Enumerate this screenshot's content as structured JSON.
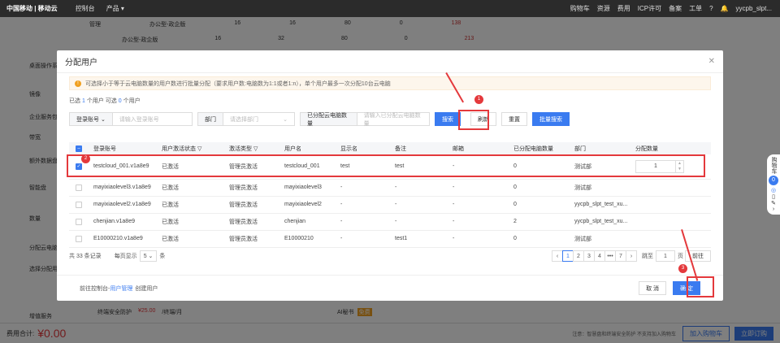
{
  "topbar": {
    "logo": "中国移动 | 移动云",
    "nav": [
      "控制台",
      "产品 ▾"
    ],
    "right": [
      "购物车",
      "资源",
      "费用",
      "ICP许可",
      "备案",
      "工单",
      "?",
      "🔔",
      "yycpb_slpt..."
    ]
  },
  "background": {
    "sidebar": [
      "桌面操作系统",
      "镜像",
      "企业服务包",
      "带宽",
      "额外数据盘",
      "智能盘",
      "数量",
      "分配云电脑",
      "选择分配用户",
      "增值服务"
    ],
    "rows": [
      [
        "管理",
        "办公型-政企版",
        "16",
        "16",
        "80",
        "0",
        "138"
      ],
      [
        "",
        "办公型-政企版",
        "16",
        "32",
        "80",
        "0",
        "213"
      ]
    ],
    "addons": [
      "终端安全防护",
      "¥25.00",
      "/终端/月",
      "AI秘书",
      "免费"
    ],
    "total_label": "费用合计:",
    "total": "¥0.00",
    "bottom_note": "注意：智慧盘和终端安全防护 不支持加入购物车",
    "add_cart": "加入购物车",
    "buy_now": "立即订购"
  },
  "modal": {
    "title": "分配用户",
    "notice": "可选择小于等于云电脑数量的用户数进行批量分配（要求用户数:电脑数为1:1或者1:n），单个用户最多一次分配10台云电脑",
    "selected": {
      "pre": "已选",
      "count1": "1",
      "mid": "个用户 可选",
      "count2": "0",
      "post": "个用户"
    },
    "filters": {
      "account_label": "登录账号",
      "account_placeholder": "请输入登录账号",
      "dept_label": "部门",
      "dept_placeholder": "请选择部门",
      "count_label": "已分配云电脑数量",
      "count_placeholder": "请输入已分配云电脑数量"
    },
    "buttons": {
      "search": "搜索",
      "refresh": "刷新",
      "reset": "重置",
      "batch": "批量搜索",
      "cancel": "取 消",
      "confirm": "确 定"
    },
    "columns": [
      "登录账号",
      "用户激活状态 ▽",
      "激活类型 ▽",
      "用户名",
      "显示名",
      "备注",
      "邮箱",
      "已分配电脑数量",
      "部门",
      "分配数量"
    ],
    "rows": [
      {
        "checked": true,
        "cells": [
          "testcloud_001.v1a8e9",
          "已激活",
          "管理员激活",
          "testcloud_001",
          "test",
          "test",
          "-",
          "0",
          "测试部"
        ],
        "qty": "1"
      },
      {
        "checked": false,
        "cells": [
          "mayixiaolevel3.v1a8e9",
          "已激活",
          "管理员激活",
          "mayixiaolevel3",
          "-",
          "-",
          "-",
          "0",
          "测试部"
        ]
      },
      {
        "checked": false,
        "cells": [
          "mayixiaolevel2.v1a8e9",
          "已激活",
          "管理员激活",
          "mayixiaolevel2",
          "-",
          "-",
          "-",
          "0",
          "yycpb_slpt_test_xu..."
        ]
      },
      {
        "checked": false,
        "cells": [
          "chenjian.v1a8e9",
          "已激活",
          "管理员激活",
          "chenjian",
          "-",
          "-",
          "-",
          "2",
          "yycpb_slpt_test_xu..."
        ]
      },
      {
        "checked": false,
        "cells": [
          "E10000210.v1a8e9",
          "已激活",
          "管理员激活",
          "E10000210",
          "-",
          "test1",
          "-",
          "0",
          "测试部"
        ]
      }
    ],
    "pagination": {
      "total": "共 33 条记录",
      "per_page_label": "每页显示",
      "per_page": "5",
      "unit": "条",
      "pages": [
        "‹",
        "1",
        "2",
        "3",
        "4",
        "•••",
        "7",
        "›"
      ],
      "goto_label": "跳至",
      "goto_value": "1",
      "page_unit": "页",
      "goto_btn": "前往"
    },
    "footer": {
      "pre": "前往控制台-",
      "link": "用户管理",
      "post": "创建用户"
    }
  },
  "annotations": [
    "1",
    "2",
    "3"
  ],
  "dock": {
    "cart": "购物车",
    "cart_count": "0"
  }
}
